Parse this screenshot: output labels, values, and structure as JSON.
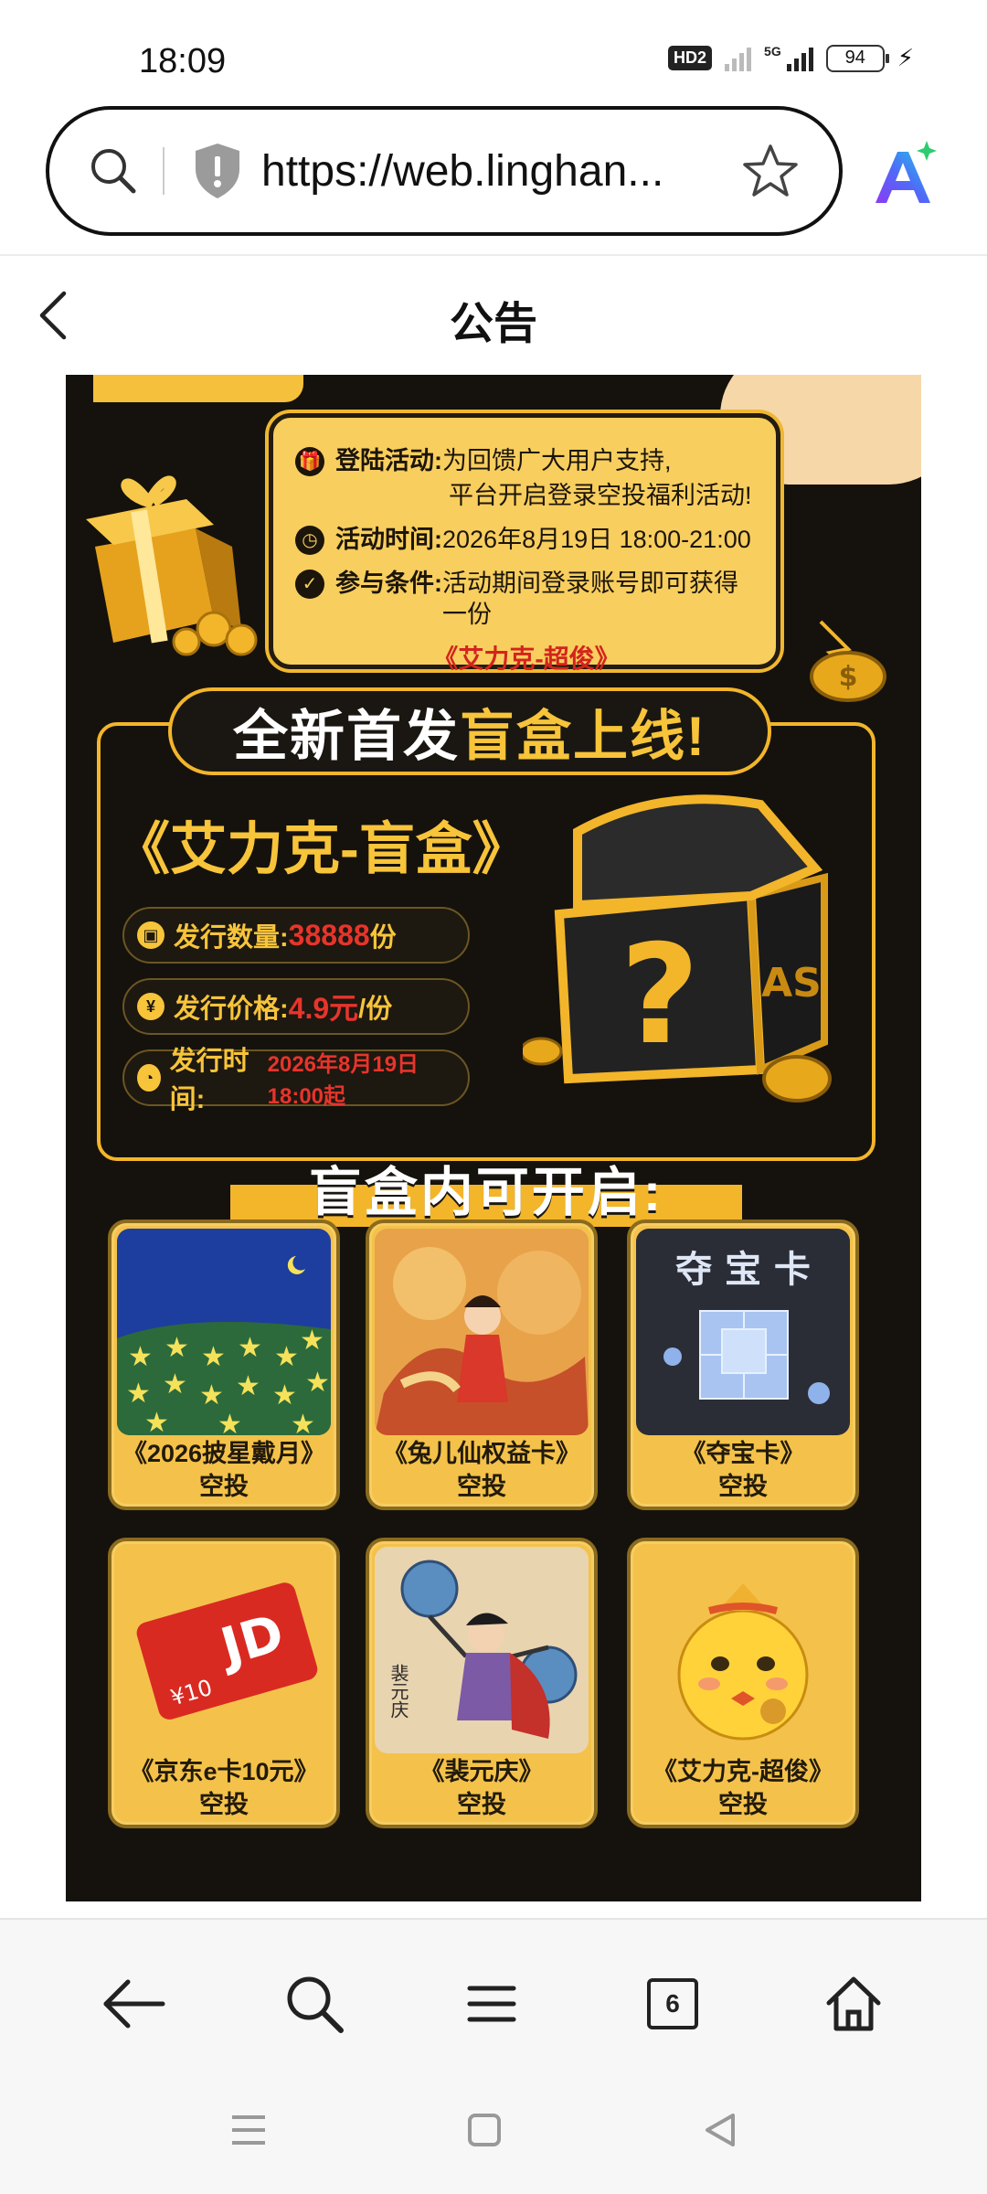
{
  "status_bar": {
    "time": "18:09",
    "hd_label": "HD2",
    "network_label": "5G",
    "battery": "94"
  },
  "browser": {
    "url": "https://web.linghan...",
    "icons": [
      "search-icon",
      "shield-icon",
      "star-icon",
      "ai-assistant-icon"
    ]
  },
  "page": {
    "title": "公告"
  },
  "poster": {
    "info": {
      "login_label": "登陆活动:",
      "login_text_1": "为回馈广大用户支持,",
      "login_text_2": "平台开启登录空投福利活动!",
      "time_label": "活动时间:",
      "time_value": "2026年8月19日 18:00-21:00",
      "cond_label": "参与条件:",
      "cond_value": "活动期间登录账号即可获得一份",
      "prize": "《艾力克-超俊》"
    },
    "launch": {
      "banner_white": "全新首发",
      "banner_yellow": "盲盒上线!",
      "box_name": "《艾力克-盲盒》",
      "qty_label": "发行数量:",
      "qty_value": "38888",
      "qty_unit": "份",
      "price_label": "发行价格:",
      "price_value": "4.9元",
      "price_unit": "/份",
      "release_label": "发行时间:",
      "release_value": "2026年8月19日 18:00起",
      "chest_mark": "AS"
    },
    "contents_title": "盲盒内可开启:",
    "items": [
      {
        "name": "《2026披星戴月》",
        "tag": "空投"
      },
      {
        "name": "《兔儿仙权益卡》",
        "tag": "空投"
      },
      {
        "name": "《夺宝卡》",
        "tag": "空投",
        "art_text": "夺 宝 卡"
      },
      {
        "name": "《京东e卡10元》",
        "tag": "空投",
        "art_text": "JD",
        "art_sub": "¥10"
      },
      {
        "name": "《裴元庆》",
        "tag": "空投",
        "art_text": "裴元庆"
      },
      {
        "name": "《艾力克-超俊》",
        "tag": "空投"
      }
    ]
  },
  "bottom_nav": {
    "tab_count": "6"
  }
}
